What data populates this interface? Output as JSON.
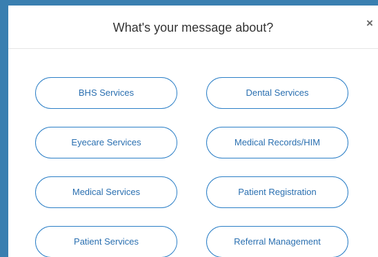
{
  "modal": {
    "title": "What's your message about?",
    "close_label": "×"
  },
  "options": [
    {
      "label": "BHS Services"
    },
    {
      "label": "Dental Services"
    },
    {
      "label": "Eyecare Services"
    },
    {
      "label": "Medical Records/HIM"
    },
    {
      "label": "Medical Services"
    },
    {
      "label": "Patient Registration"
    },
    {
      "label": "Patient Services"
    },
    {
      "label": "Referral Management"
    }
  ],
  "colors": {
    "accent": "#2a7ec6",
    "backdrop": "#3a7fb0"
  }
}
